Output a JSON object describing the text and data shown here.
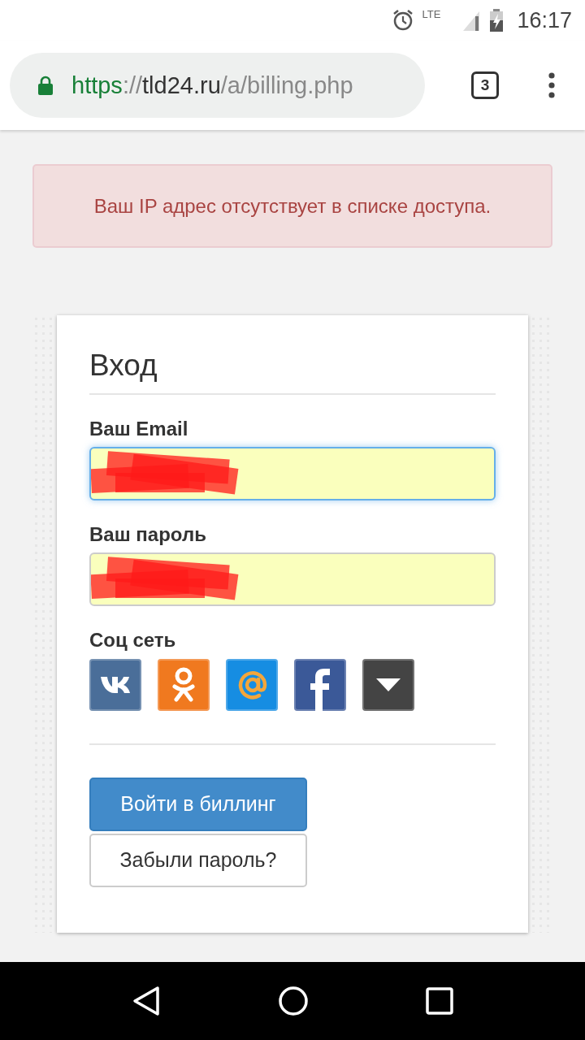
{
  "status_bar": {
    "network": "LTE",
    "time": "16:17"
  },
  "address_bar": {
    "scheme": "https",
    "separator": "://",
    "host": "tld24.ru",
    "path": "/a/billing.php",
    "secure": true,
    "tab_count": "3"
  },
  "alert": {
    "text": "Ваш IP адрес отсутствует в списке доступа."
  },
  "login_form": {
    "title": "Вход",
    "fields": [
      {
        "label": "Ваш Email",
        "focused": true,
        "redacted": true
      },
      {
        "label": "Ваш пароль",
        "focused": false,
        "redacted": true
      }
    ],
    "social_label": "Соц сеть",
    "social_buttons": [
      {
        "kind": "vk",
        "color": "#4a6e99"
      },
      {
        "kind": "ok",
        "color": "#f0791f"
      },
      {
        "kind": "mail",
        "color": "#168de2"
      },
      {
        "kind": "facebook",
        "color": "#3b5998"
      },
      {
        "kind": "more",
        "color": "#444444"
      }
    ],
    "buttons": [
      {
        "kind": "primary",
        "label": "Войти в биллинг"
      },
      {
        "kind": "default",
        "label": "Забыли пароль?"
      }
    ]
  }
}
